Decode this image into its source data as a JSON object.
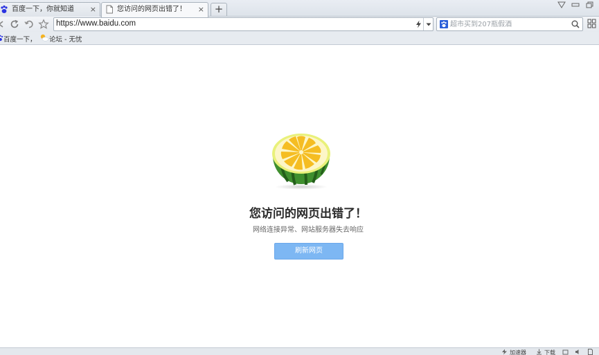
{
  "tabs": [
    {
      "title": "百度一下，你就知道",
      "active": false
    },
    {
      "title": "您访问的网页出错了！",
      "active": true
    }
  ],
  "new_tab_label": "+",
  "close_glyph": "×",
  "address_bar": {
    "url": "https://www.baidu.com"
  },
  "search_box": {
    "placeholder": "超市买到207瓶假酒"
  },
  "bookmarks": [
    {
      "label": "百度一下，",
      "icon": "baidu-paw-icon"
    },
    {
      "label": "论坛 - 无忧",
      "icon": "cloud-sun-icon"
    }
  ],
  "error_page": {
    "title": "您访问的网页出错了！",
    "subtitle": "网络连接异常、网站服务器失去响应",
    "refresh_button": "刷新网页",
    "illustration": "lemon-watermelon-icon"
  },
  "status_bar": {
    "accelerator": "加速器",
    "download": "下载"
  },
  "colors": {
    "accent_button": "#7db7f3",
    "lemon": "#f7c325",
    "melon_green": "#3a8a2c"
  }
}
